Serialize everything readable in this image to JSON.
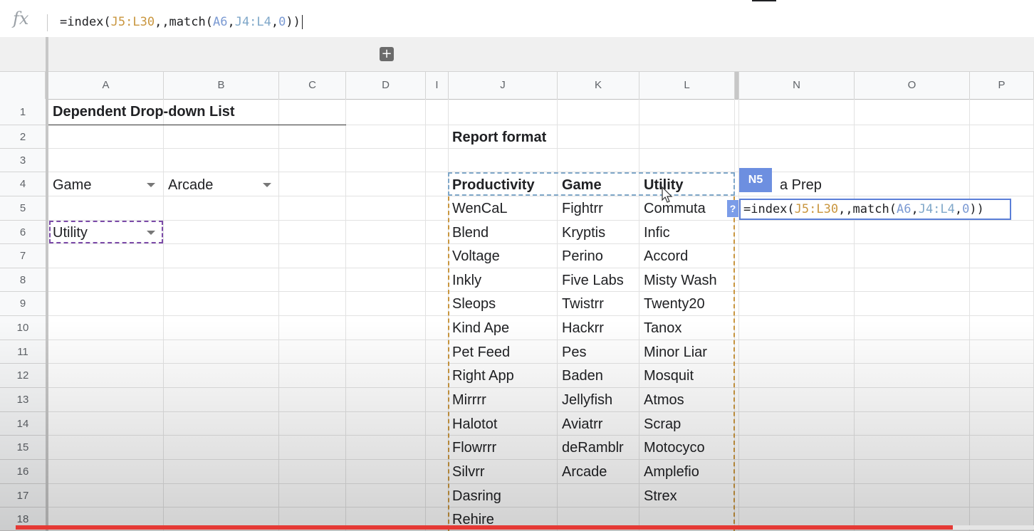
{
  "formula_bar": {
    "icon": "fx",
    "formula_parts": [
      {
        "t": "=index(",
        "c": ""
      },
      {
        "t": "J5:L30",
        "c": "ref-a"
      },
      {
        "t": ",,match(",
        "c": ""
      },
      {
        "t": "A6",
        "c": "ref-b"
      },
      {
        "t": ",",
        "c": ""
      },
      {
        "t": "J4:L4",
        "c": "ref-c"
      },
      {
        "t": ",",
        "c": ""
      },
      {
        "t": "0",
        "c": "ref-b"
      },
      {
        "t": "))",
        "c": ""
      }
    ]
  },
  "add_button": "+",
  "columns": [
    "A",
    "B",
    "C",
    "D",
    "I",
    "J",
    "K",
    "L",
    "N",
    "O",
    "P"
  ],
  "rows": [
    "1",
    "2",
    "3",
    "4",
    "5",
    "6",
    "7",
    "8",
    "9",
    "10",
    "11",
    "12",
    "13",
    "14",
    "15",
    "16",
    "17",
    "18"
  ],
  "sheet": {
    "title": "Dependent Drop-down List",
    "dropdown_a4": "Game",
    "dropdown_b4": "Arcade",
    "dropdown_a6": "Utility",
    "report_format": "Report format",
    "headers": {
      "j": "Productivity",
      "k": "Game",
      "l": "Utility"
    },
    "n4_partial": "a Prep",
    "col_j": [
      "WenCaL",
      "Blend",
      "Voltage",
      "Inkly",
      "Sleops",
      "Kind Ape",
      "Pet Feed",
      "Right App",
      "Mirrrr",
      "Halotot",
      "Flowrrr",
      "Silvrr",
      "Dasring",
      "Rehire"
    ],
    "col_k": [
      "Fightrr",
      "Kryptis",
      "Perino",
      "Five Labs",
      "Twistrr",
      "Hackrr",
      "Pes",
      "Baden",
      "Jellyfish",
      "Aviatrr",
      "deRamblr",
      "Arcade"
    ],
    "col_l": [
      "Commuta",
      "Infic",
      "Accord",
      "Misty Wash",
      "Twenty20",
      "Tanox",
      "Minor Liar",
      "Mosquit",
      "Atmos",
      "Scrap",
      "Motocyco",
      "Amplefio",
      "Strex"
    ]
  },
  "active_cell": {
    "label": "N5",
    "help": "?",
    "formula_parts": [
      {
        "t": "=index(",
        "c": ""
      },
      {
        "t": "J5:L30",
        "c": "ref-a"
      },
      {
        "t": ",,match(",
        "c": ""
      },
      {
        "t": "A6",
        "c": "ref-b"
      },
      {
        "t": ",",
        "c": ""
      },
      {
        "t": "J4:L4",
        "c": "ref-c"
      },
      {
        "t": ",",
        "c": ""
      },
      {
        "t": "0",
        "c": "ref-b"
      },
      {
        "t": "))",
        "c": ""
      }
    ]
  },
  "video_progress": 0.92,
  "colors": {
    "progress": "#e53935",
    "range_data": "#c9963f",
    "range_header": "#7fa7c9",
    "criteria": "#7b4aa8",
    "active": "#5b7fd8"
  }
}
